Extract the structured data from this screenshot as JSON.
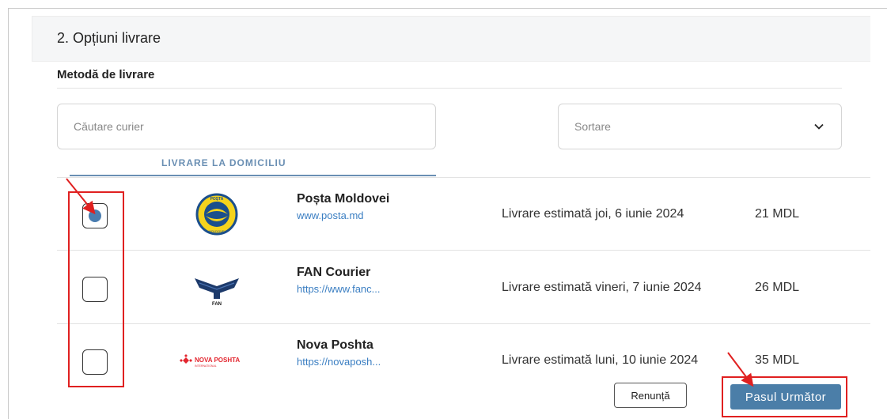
{
  "section": {
    "title": "2. Opțiuni livrare"
  },
  "method": {
    "title": "Metodă de livrare"
  },
  "search": {
    "placeholder": "Căutare curier"
  },
  "sort": {
    "placeholder": "Sortare"
  },
  "tab": {
    "label": "LIVRARE LA DOMICILIU"
  },
  "couriers": [
    {
      "name": "Poșta Moldovei",
      "url": "www.posta.md",
      "estimate": "Livrare estimată joi, 6 iunie 2024",
      "price": "21 MDL",
      "selected": true,
      "logo_text": [
        "POȘTA",
        "MOLDOVEI"
      ]
    },
    {
      "name": "FAN Courier",
      "url": "https://www.fanc...",
      "estimate": "Livrare estimată vineri, 7 iunie 2024",
      "price": "26 MDL",
      "selected": false,
      "logo_text": [
        "FAN"
      ]
    },
    {
      "name": "Nova Poshta",
      "url": "https://novaposh...",
      "estimate": "Livrare estimată luni, 10 iunie 2024",
      "price": "35 MDL",
      "selected": false,
      "logo_text": [
        "NOVA POSHTA",
        "INTERNATIONAL"
      ]
    }
  ],
  "buttons": {
    "cancel": "Renunță",
    "next": "Pasul Următor"
  },
  "colors": {
    "accent": "#4b7ea8",
    "link": "#3a7ec2",
    "annotation": "#e02020"
  },
  "icons": {
    "sort": "chevron-down-icon"
  }
}
